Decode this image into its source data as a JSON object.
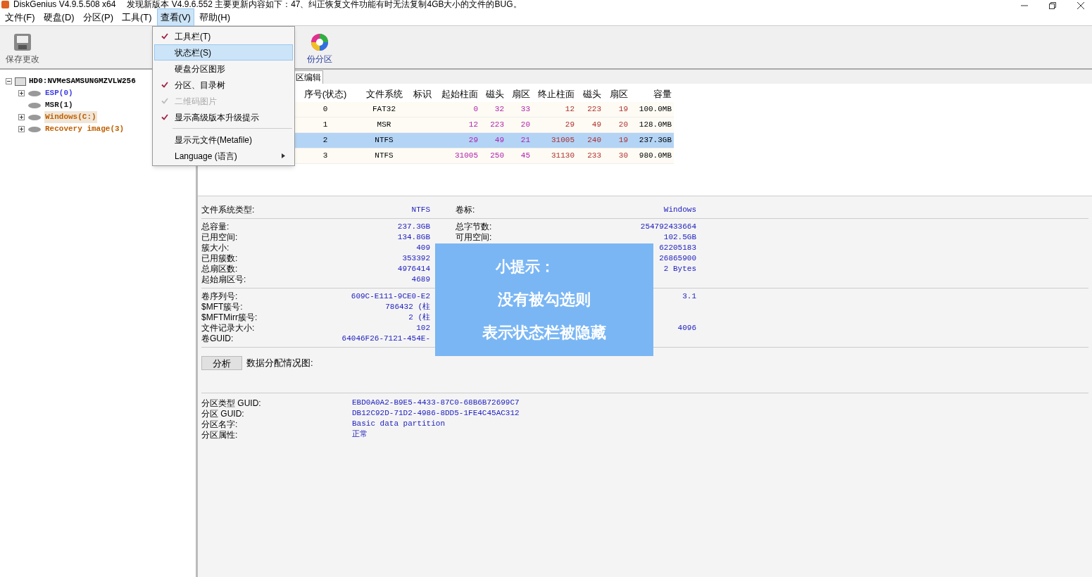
{
  "title_bar": {
    "app_title": "DiskGenius V4.9.5.508 x64",
    "notice": "发现新版本 V4.9.6.552 主要更新内容如下：47、纠正恢复文件功能有时无法复制4GB大小的文件的BUG。"
  },
  "menu_bar": [
    {
      "label": "文件(F)",
      "selected": false
    },
    {
      "label": "硬盘(D)",
      "selected": false
    },
    {
      "label": "分区(P)",
      "selected": false
    },
    {
      "label": "工具(T)",
      "selected": false
    },
    {
      "label": "查看(V)",
      "selected": true
    },
    {
      "label": "帮助(H)",
      "selected": false
    }
  ],
  "view_menu": [
    {
      "kind": "item",
      "label": "工具栏(T)",
      "checked": true,
      "disabled": false,
      "selected": false,
      "divider_before": false
    },
    {
      "kind": "item",
      "label": "状态栏(S)",
      "checked": false,
      "disabled": false,
      "selected": true,
      "divider_before": false
    },
    {
      "kind": "item",
      "label": "硬盘分区图形",
      "checked": false,
      "disabled": false,
      "selected": false,
      "divider_before": false
    },
    {
      "kind": "item",
      "label": "分区、目录树",
      "checked": true,
      "disabled": false,
      "selected": false,
      "divider_before": false
    },
    {
      "kind": "item",
      "label": "二维码图片",
      "checked": true,
      "disabled": true,
      "selected": false,
      "divider_before": false
    },
    {
      "kind": "item",
      "label": "显示高级版本升级提示",
      "checked": true,
      "disabled": false,
      "selected": false,
      "divider_before": false
    },
    {
      "kind": "item",
      "label": "显示元文件(Metafile)",
      "checked": false,
      "disabled": false,
      "selected": false,
      "divider_before": true
    },
    {
      "kind": "submenu",
      "label": "Language (语言)",
      "checked": false,
      "disabled": false,
      "selected": false,
      "divider_before": false
    }
  ],
  "toolbar": [
    {
      "kind": "save",
      "label": "保存更改"
    },
    {
      "kind": "pie",
      "label": "份分区"
    }
  ],
  "tab": {
    "label": "区编辑"
  },
  "tree": {
    "label": "HD0:NVMeSAMSUNGMZVLW256",
    "expanded": true,
    "children": [
      {
        "label": "ESP(0)",
        "color": "#4040e0",
        "expandable": true,
        "selected": false
      },
      {
        "label": "MSR(1)",
        "color": "#202020",
        "expandable": false,
        "selected": false
      },
      {
        "label": "Windows(C:)",
        "color": "#c06000",
        "expandable": true,
        "selected": true
      },
      {
        "label": "Recovery image(3)",
        "color": "#c06000",
        "expandable": true,
        "selected": false
      }
    ]
  },
  "table": {
    "columns": [
      {
        "label": "序号(状态)",
        "kind": "center"
      },
      {
        "label": "文件系统",
        "kind": "center"
      },
      {
        "label": "标识",
        "kind": "center"
      },
      {
        "label": "起始柱面",
        "kind": "start"
      },
      {
        "label": "磁头",
        "kind": "start"
      },
      {
        "label": "扇区",
        "kind": "start"
      },
      {
        "label": "终止柱面",
        "kind": "end"
      },
      {
        "label": "磁头",
        "kind": "end"
      },
      {
        "label": "扇区",
        "kind": "end"
      },
      {
        "label": "容量",
        "kind": "plain"
      }
    ],
    "rows": [
      {
        "selected": false,
        "cells": [
          "0",
          "FAT32",
          "",
          "0",
          "32",
          "33",
          "12",
          "223",
          "19",
          "100.0MB"
        ]
      },
      {
        "selected": false,
        "cells": [
          "1",
          "MSR",
          "",
          "12",
          "223",
          "20",
          "29",
          "49",
          "20",
          "128.0MB"
        ]
      },
      {
        "selected": true,
        "cells": [
          "2",
          "NTFS",
          "",
          "29",
          "49",
          "21",
          "31005",
          "240",
          "19",
          "237.3GB"
        ]
      },
      {
        "selected": false,
        "cells": [
          "3",
          "NTFS",
          "",
          "31005",
          "250",
          "45",
          "31130",
          "233",
          "30",
          "980.0MB"
        ]
      }
    ]
  },
  "details": [
    {
      "rows": [
        {
          "label": "文件系统类型:",
          "value": "NTFS",
          "label2": "卷标:",
          "value2": "Windows"
        }
      ]
    },
    {
      "rows": [
        {
          "label": "总容量:",
          "value": "237.3GB",
          "label2": "总字节数:",
          "value2": "254792433664"
        },
        {
          "label": "已用空间:",
          "value": "134.8GB",
          "label2": "可用空间:",
          "value2": "102.5GB"
        },
        {
          "label": "簇大小:",
          "value": "409",
          "label2": "",
          "value2": "62205183"
        },
        {
          "label": "已用簇数:",
          "value": "353392",
          "label2": "",
          "value2": "26865900"
        },
        {
          "label": "总扇区数:",
          "value": "4976414",
          "label2": "",
          "value2": "2 Bytes"
        },
        {
          "label": "起始扇区号:",
          "value": "4689",
          "label2": "",
          "value2": ""
        }
      ]
    },
    {
      "rows": [
        {
          "label": "卷序列号:",
          "value": "609C-E111-9CE0-E2",
          "label2": "",
          "value2": "3.1"
        },
        {
          "label": "$MFT簇号:",
          "value": "786432 (柱",
          "label2": "",
          "value2": ""
        },
        {
          "label": "$MFTMirr簇号:",
          "value": "2 (柱",
          "label2": "",
          "value2": ""
        },
        {
          "label": "文件记录大小:",
          "value": "102",
          "label2": "",
          "value2": "4096"
        },
        {
          "label": "卷GUID:",
          "value": "64046F26-7121-454E-",
          "label2": "",
          "value2": ""
        }
      ]
    }
  ],
  "analyze": {
    "button": "分析",
    "caption": "数据分配情况图:"
  },
  "guid_rows": [
    {
      "label": "分区类型 GUID:",
      "value": "EBD0A0A2-B9E5-4433-87C0-68B6B72699C7"
    },
    {
      "label": "分区 GUID:",
      "value": "DB12C92D-71D2-4986-8DD5-1FE4C45AC312"
    },
    {
      "label": "分区名字:",
      "value": "Basic data partition"
    },
    {
      "label": "分区属性:",
      "value": "正常"
    }
  ],
  "tip": {
    "title": "小提示：",
    "lines": [
      "没有被勾选则",
      "表示状态栏被隐藏"
    ]
  }
}
